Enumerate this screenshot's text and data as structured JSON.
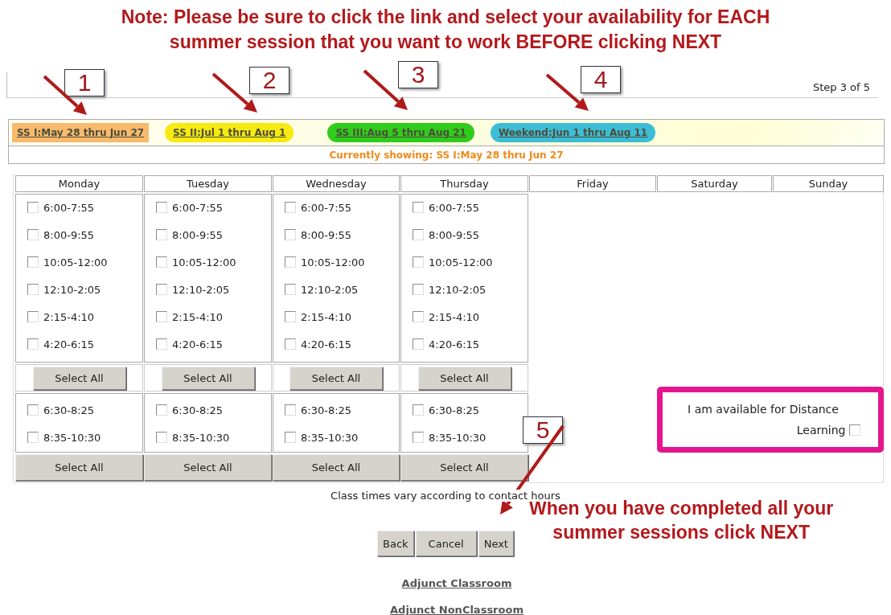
{
  "note": {
    "lines": [
      "Note:  Please be sure to click the link and select your availability for EACH",
      "summer session that you want to work BEFORE clicking NEXT"
    ]
  },
  "step": "Step 3 of 5",
  "callouts": [
    {
      "label": "1"
    },
    {
      "label": "2"
    },
    {
      "label": "3"
    },
    {
      "label": "4"
    },
    {
      "label": "5"
    }
  ],
  "sessions": [
    {
      "label": "SS I:May 28 thru Jun 27",
      "color": "#f8ba6c",
      "selected": true
    },
    {
      "label": "SS II:Jul 1 thru Aug 1",
      "color": "#f6ea12",
      "selected": false
    },
    {
      "label": "SS III:Aug 5 thru Aug 21",
      "color": "#2fcc1c",
      "selected": false
    },
    {
      "label": "Weekend:Jun 1 thru Aug 11",
      "color": "#3dbcd6",
      "selected": false
    }
  ],
  "currently_showing": "Currently showing: SS I:May 28 thru Jun 27",
  "days": [
    {
      "name": "Monday",
      "morning": [
        {
          "label": "6:00-7:55",
          "checked": false
        },
        {
          "label": "8:00-9:55",
          "checked": false
        },
        {
          "label": "10:05-12:00",
          "checked": false
        },
        {
          "label": "12:10-2:05",
          "checked": false
        },
        {
          "label": "2:15-4:10",
          "checked": false
        },
        {
          "label": "4:20-6:15",
          "checked": false
        }
      ],
      "morning_button": "Select All",
      "evening": [
        {
          "label": "6:30-8:25",
          "checked": false
        },
        {
          "label": "8:35-10:30",
          "checked": false
        }
      ],
      "evening_button": "Select All"
    },
    {
      "name": "Tuesday",
      "morning": [
        {
          "label": "6:00-7:55",
          "checked": false
        },
        {
          "label": "8:00-9:55",
          "checked": false
        },
        {
          "label": "10:05-12:00",
          "checked": false
        },
        {
          "label": "12:10-2:05",
          "checked": false
        },
        {
          "label": "2:15-4:10",
          "checked": false
        },
        {
          "label": "4:20-6:15",
          "checked": false
        }
      ],
      "morning_button": "Select All",
      "evening": [
        {
          "label": "6:30-8:25",
          "checked": false
        },
        {
          "label": "8:35-10:30",
          "checked": false
        }
      ],
      "evening_button": "Select All"
    },
    {
      "name": "Wednesday",
      "morning": [
        {
          "label": "6:00-7:55",
          "checked": false
        },
        {
          "label": "8:00-9:55",
          "checked": false
        },
        {
          "label": "10:05-12:00",
          "checked": false
        },
        {
          "label": "12:10-2:05",
          "checked": false
        },
        {
          "label": "2:15-4:10",
          "checked": false
        },
        {
          "label": "4:20-6:15",
          "checked": false
        }
      ],
      "morning_button": "Select All",
      "evening": [
        {
          "label": "6:30-8:25",
          "checked": false
        },
        {
          "label": "8:35-10:30",
          "checked": false
        }
      ],
      "evening_button": "Select All"
    },
    {
      "name": "Thursday",
      "morning": [
        {
          "label": "6:00-7:55",
          "checked": false
        },
        {
          "label": "8:00-9:55",
          "checked": false
        },
        {
          "label": "10:05-12:00",
          "checked": false
        },
        {
          "label": "12:10-2:05",
          "checked": false
        },
        {
          "label": "2:15-4:10",
          "checked": false
        },
        {
          "label": "4:20-6:15",
          "checked": false
        }
      ],
      "morning_button": "Select All",
      "evening": [
        {
          "label": "6:30-8:25",
          "checked": false
        },
        {
          "label": "8:35-10:30",
          "checked": false
        }
      ],
      "evening_button": "Select All"
    },
    {
      "name": "Friday"
    },
    {
      "name": "Saturday"
    },
    {
      "name": "Sunday"
    }
  ],
  "distance_learning": {
    "label": "I am available for Distance Learning",
    "checked": false
  },
  "hint": "Class times vary according to contact hours",
  "completion_note": {
    "lines": [
      "When you have completed all your",
      "summer sessions click NEXT"
    ]
  },
  "buttons": [
    "Back",
    "Cancel",
    "Next"
  ],
  "links": [
    "Adjunct Classroom",
    "Adjunct NonClassroom"
  ]
}
